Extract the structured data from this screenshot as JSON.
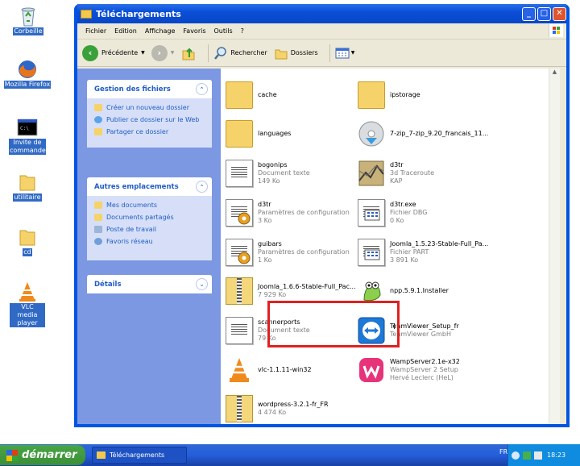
{
  "desktop": {
    "icons": [
      {
        "label": "Corbeille",
        "icon": "recycle-bin-icon"
      },
      {
        "label": "Mozilla Firefox",
        "icon": "firefox-icon"
      },
      {
        "label": "Invite de commandes",
        "icon": "command-prompt-icon"
      },
      {
        "label": "utilitaire",
        "icon": "folder-icon"
      },
      {
        "label": "cd",
        "icon": "folder-icon"
      },
      {
        "label": "VLC media player",
        "icon": "vlc-icon"
      }
    ]
  },
  "window": {
    "title": "Téléchargements",
    "menu": [
      "Fichier",
      "Edition",
      "Affichage",
      "Favoris",
      "Outils",
      "?"
    ],
    "toolbar": {
      "back_label": "Précédente",
      "search_label": "Rechercher",
      "folders_label": "Dossiers"
    }
  },
  "tasks": {
    "files_title": "Gestion des fichiers",
    "files_items": [
      "Créer un nouveau dossier",
      "Publier ce dossier sur le Web",
      "Partager ce dossier"
    ],
    "places_title": "Autres emplacements",
    "places_items": [
      "Mes documents",
      "Documents partagés",
      "Poste de travail",
      "Favoris réseau"
    ],
    "details_title": "Détails"
  },
  "files": [
    {
      "name": "cache",
      "line2": "",
      "line3": "",
      "kind": "folder"
    },
    {
      "name": "ipstorage",
      "line2": "",
      "line3": "",
      "kind": "folder"
    },
    {
      "name": "languages",
      "line2": "",
      "line3": "",
      "kind": "folder"
    },
    {
      "name": "7-zip_7-zip_9.20_francais_11...",
      "line2": "",
      "line3": "",
      "kind": "installer"
    },
    {
      "name": "bogonips",
      "line2": "Document texte",
      "line3": "149 Ko",
      "kind": "doc"
    },
    {
      "name": "d3tr",
      "line2": "3d Traceroute",
      "line3": "KAP",
      "kind": "app"
    },
    {
      "name": "d3tr",
      "line2": "Paramètres de configuration",
      "line3": "3 Ko",
      "kind": "config"
    },
    {
      "name": "d3tr.exe",
      "line2": "Fichier DBG",
      "line3": "0 Ko",
      "kind": "dbg"
    },
    {
      "name": "guibars",
      "line2": "Paramètres de configuration",
      "line3": "1 Ko",
      "kind": "config"
    },
    {
      "name": "Joomla_1.5.23-Stable-Full_Pa...",
      "line2": "Fichier PART",
      "line3": "3 891 Ko",
      "kind": "dbg"
    },
    {
      "name": "Joomla_1.6.6-Stable-Full_Pac...",
      "line2": "7 929 Ko",
      "line3": "",
      "kind": "zip"
    },
    {
      "name": "npp.5.9.1.Installer",
      "line2": "",
      "line3": "",
      "kind": "npp"
    },
    {
      "name": "scannerports",
      "line2": "Document texte",
      "line3": "79 Ko",
      "kind": "doc"
    },
    {
      "name": "TeamViewer_Setup_fr",
      "line2": "TeamViewer GmbH",
      "line3": "",
      "kind": "teamviewer"
    },
    {
      "name": "vlc-1.1.11-win32",
      "line2": "",
      "line3": "",
      "kind": "vlc"
    },
    {
      "name": "WampServer2.1e-x32",
      "line2": "WampServer 2 Setup",
      "line3": "Hervé Leclerc (HeL)",
      "kind": "wamp"
    },
    {
      "name": "wordpress-3.2.1-fr_FR",
      "line2": "4 474 Ko",
      "line3": "",
      "kind": "zip"
    }
  ],
  "taskbar": {
    "start_label": "démarrer",
    "task_label": "Téléchargements",
    "lang": "FR",
    "clock": "18:23"
  },
  "colors": {
    "highlight": "#e02020",
    "xp_blue": "#0054e3",
    "link": "#215dc6"
  }
}
